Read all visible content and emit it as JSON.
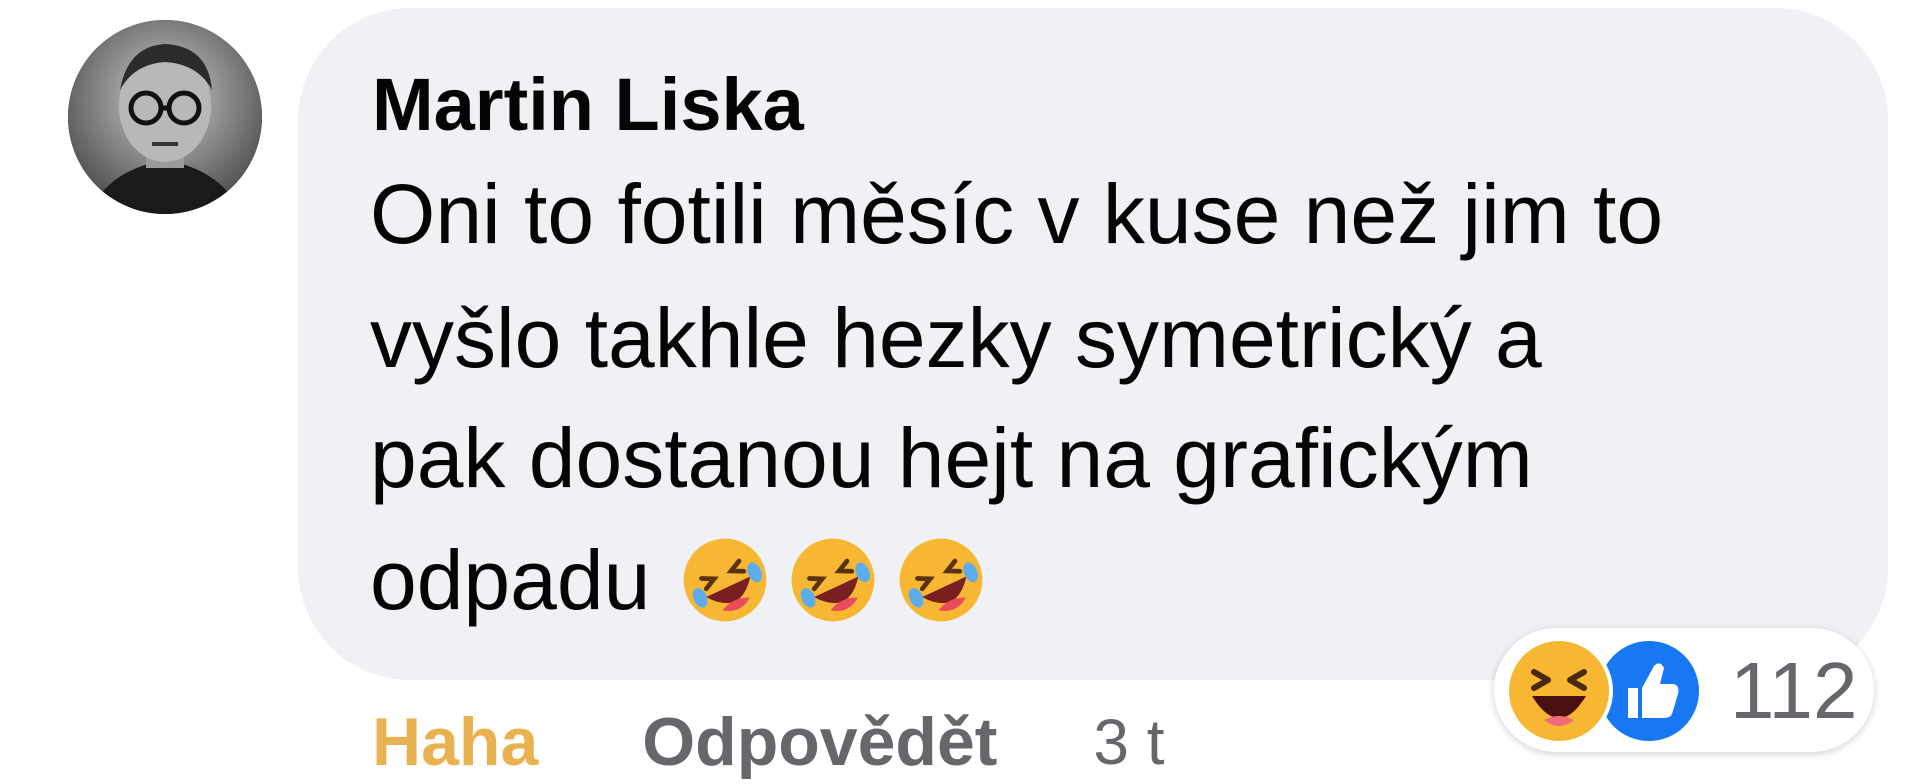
{
  "comment": {
    "author": "Martin Liska",
    "text_lines": [
      "Oni to fotili měsíc v kuse než jim to",
      "vyšlo takhle hezky symetrický a",
      "pak dostanou hejt na grafickým",
      "odpadu"
    ],
    "emojis": [
      "rolling-on-floor-laughing",
      "rolling-on-floor-laughing",
      "rolling-on-floor-laughing"
    ]
  },
  "actions": {
    "reaction_label": "Haha",
    "reply_label": "Odpovědět",
    "time_label": "3 t"
  },
  "reactions": {
    "icons": [
      "haha-icon",
      "like-icon"
    ],
    "count": "112"
  },
  "colors": {
    "bubble": "#f0f1f5",
    "haha_active": "#e9b250",
    "muted": "#65676b",
    "like_blue": "#1877f2"
  }
}
